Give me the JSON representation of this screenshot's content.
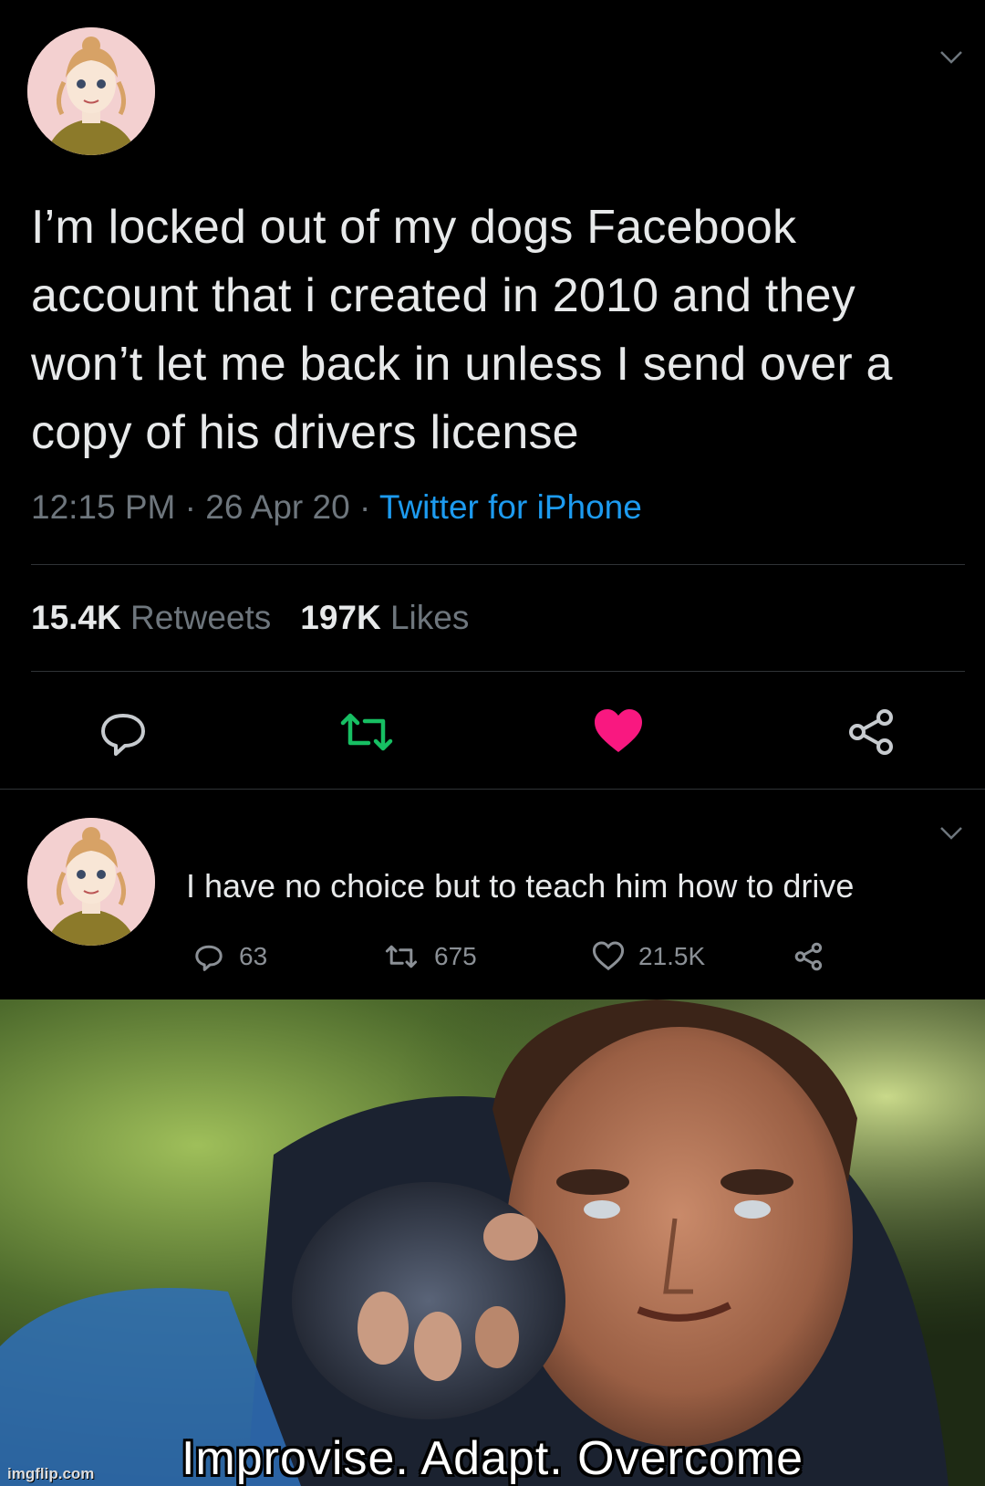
{
  "tweet": {
    "text": "I’m locked out of my dogs Facebook account that i created in 2010 and they won’t let me back in unless I send over a copy of his drivers license",
    "time": "12:15 PM",
    "date": "26 Apr 20",
    "source": "Twitter for iPhone",
    "meta_sep": " · ",
    "retweets_count": "15.4K",
    "retweets_label": "Retweets",
    "likes_count": "197K",
    "likes_label": "Likes",
    "liked": true,
    "colors": {
      "retweet": "#17bf63",
      "like": "#f91880",
      "link": "#1d9bf0"
    }
  },
  "reply": {
    "text": "I have no choice but to teach him how to drive",
    "replies": "63",
    "retweets": "675",
    "likes": "21.5K"
  },
  "meme": {
    "caption": "Improvise. Adapt. Overcome",
    "watermark": "imgflip.com"
  },
  "icons": [
    "avatar",
    "chevron-down-icon",
    "reply-icon",
    "retweet-icon",
    "like-icon",
    "share-icon"
  ]
}
